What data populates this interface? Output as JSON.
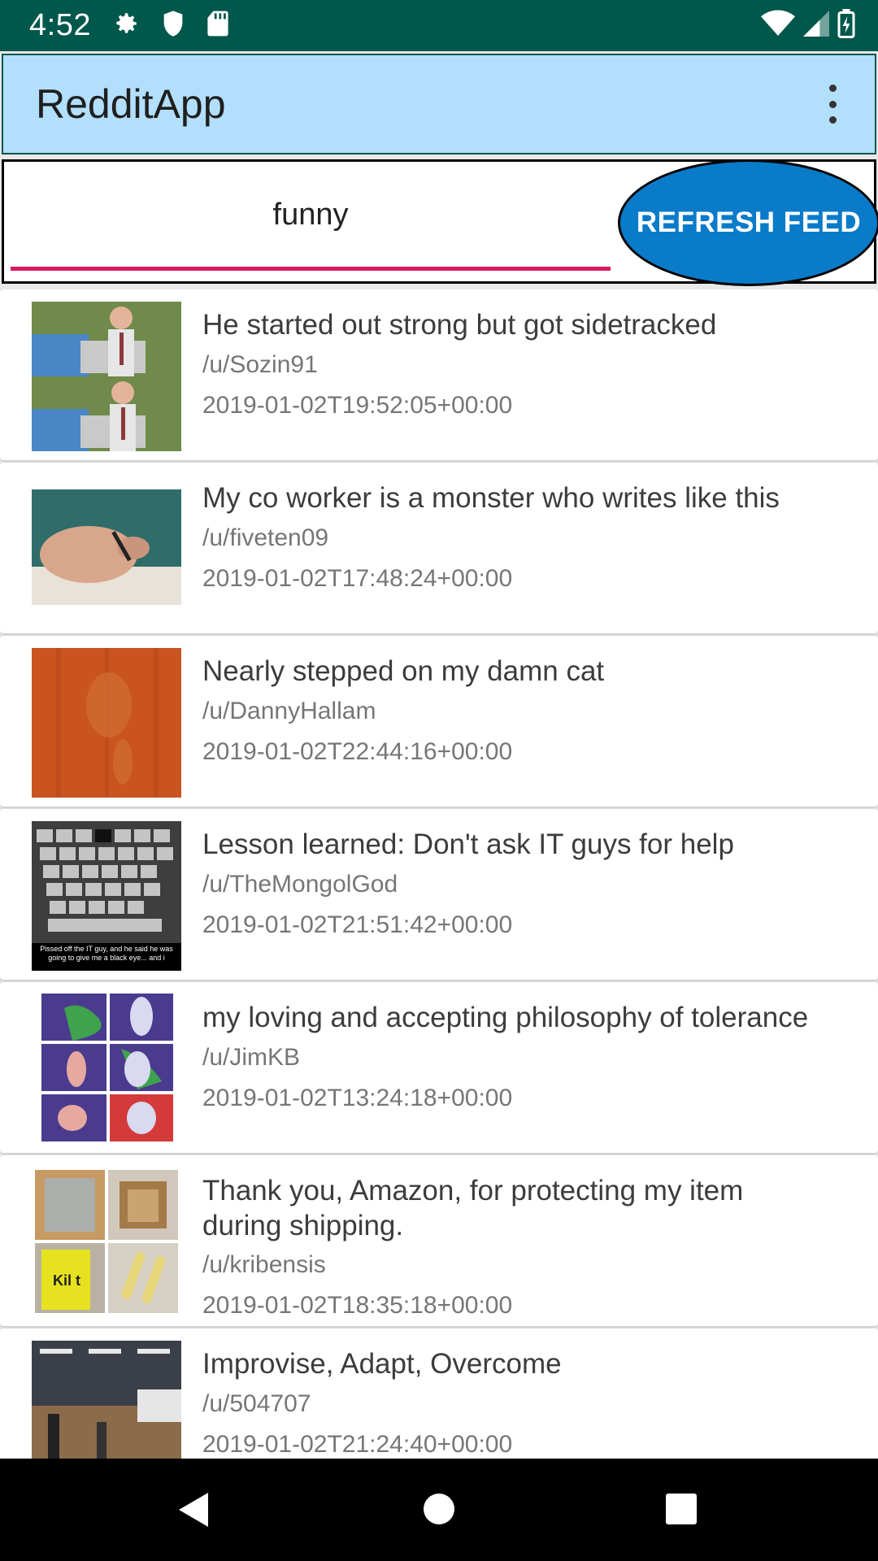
{
  "status": {
    "time": "4:52"
  },
  "appbar": {
    "title": "RedditApp"
  },
  "search": {
    "value": "funny",
    "refresh_label": "REFRESH FEED"
  },
  "posts": [
    {
      "title": "He started out strong but got sidetracked",
      "user": "/u/Sozin91",
      "time": "2019-01-02T19:52:05+00:00"
    },
    {
      "title": "My co worker is a monster who writes like this",
      "user": "/u/fiveten09",
      "time": "2019-01-02T17:48:24+00:00"
    },
    {
      "title": "Nearly stepped on my damn cat",
      "user": "/u/DannyHallam",
      "time": "2019-01-02T22:44:16+00:00"
    },
    {
      "title": "Lesson learned: Don't ask IT guys for help",
      "user": "/u/TheMongolGod",
      "time": "2019-01-02T21:51:42+00:00"
    },
    {
      "title": "my loving and accepting philosophy of tolerance",
      "user": "/u/JimKB",
      "time": "2019-01-02T13:24:18+00:00"
    },
    {
      "title": "Thank you, Amazon, for protecting my item during shipping.",
      "user": "/u/kribensis",
      "time": "2019-01-02T18:35:18+00:00"
    },
    {
      "title": "Improvise, Adapt, Overcome",
      "user": "/u/504707",
      "time": "2019-01-02T21:24:40+00:00"
    }
  ],
  "thumb_captions": {
    "keyboard": "Pissed off the IT guy, and he said he was going to give me a black eye... and i",
    "amazon_box": "Kil t"
  }
}
